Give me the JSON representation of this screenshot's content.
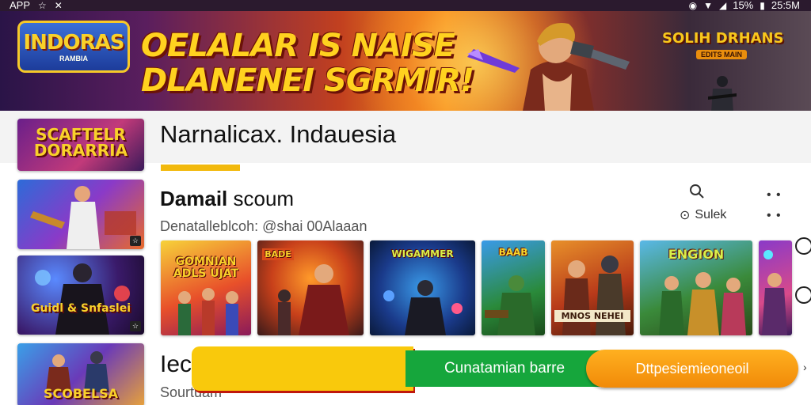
{
  "status_bar": {
    "app_label": "APP",
    "battery_percent": "15%",
    "time": "25:5M"
  },
  "banner": {
    "logo_title": "INDORAS",
    "logo_subtitle": "RAMBIA",
    "headline_line1": "OELALAR IS NAISE",
    "headline_line2": "DLANENEI SGRMIR!",
    "right_logo_title": "SOLIH DRHANS",
    "right_logo_subtitle": "EDITS MAIN"
  },
  "sidebar": {
    "items": [
      {
        "caption": "SCAFTELR DORARRIA",
        "badge": ""
      },
      {
        "caption": "",
        "badge": "☆"
      },
      {
        "caption": "Guidl & Snfaslei",
        "badge": "☆"
      },
      {
        "caption": "SCOBELSA",
        "badge": ""
      }
    ]
  },
  "header": {
    "title": "Narnalicax. Indauesia"
  },
  "section": {
    "title_bold": "Damail",
    "title_rest": " scoum",
    "subtitle": "Denatalleblcoh: @shai 00Alaaan",
    "share_label": "Sulek"
  },
  "tiles": [
    {
      "label": "GOMNIAN ADLS UJAT"
    },
    {
      "label": "BADE"
    },
    {
      "label": "WIGAMMER"
    },
    {
      "label": "BAAB"
    },
    {
      "label": "MNOS NEHEI"
    },
    {
      "label": "ENGION"
    },
    {
      "label": ""
    }
  ],
  "bottom": {
    "title": "Iec",
    "subtitle": "Sourtuam",
    "cta_green": "Cunatamian barre",
    "cta_orange": "Dttpesiemieoneoil"
  },
  "colors": {
    "accent_yellow": "#f9c90c",
    "accent_green": "#16a63c",
    "accent_orange": "#f18a08",
    "status_bg": "#2b1a2e"
  },
  "icons": [
    "signal-icon",
    "wifi-icon",
    "battery-icon",
    "location-icon",
    "search-icon",
    "share-icon",
    "more-icon",
    "chevron-right-icon"
  ]
}
